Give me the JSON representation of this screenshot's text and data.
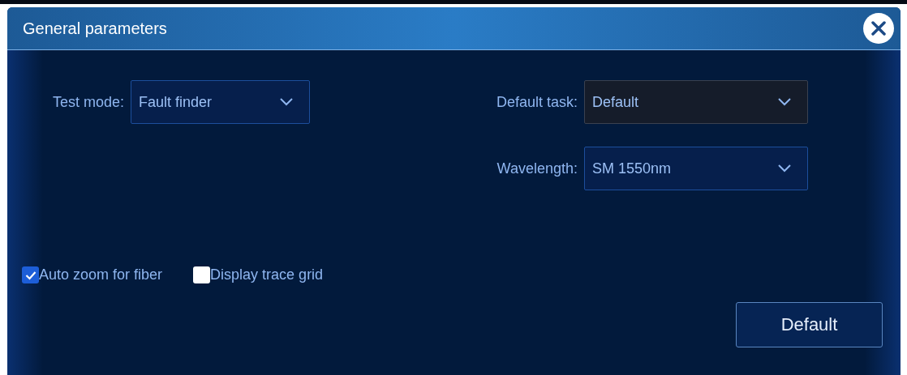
{
  "dialog": {
    "title": "General parameters"
  },
  "left_fields": [
    {
      "label": "Test mode:",
      "value": "Fault finder",
      "focused": false
    }
  ],
  "right_fields": [
    {
      "label": "Default task:",
      "value": "Default",
      "focused": true
    },
    {
      "label": "Wavelength:",
      "value": "SM 1550nm",
      "focused": false
    }
  ],
  "checkboxes": [
    {
      "label": "Auto zoom for fiber",
      "checked": true
    },
    {
      "label": "Display trace grid",
      "checked": false
    }
  ],
  "buttons": [
    "Default"
  ]
}
